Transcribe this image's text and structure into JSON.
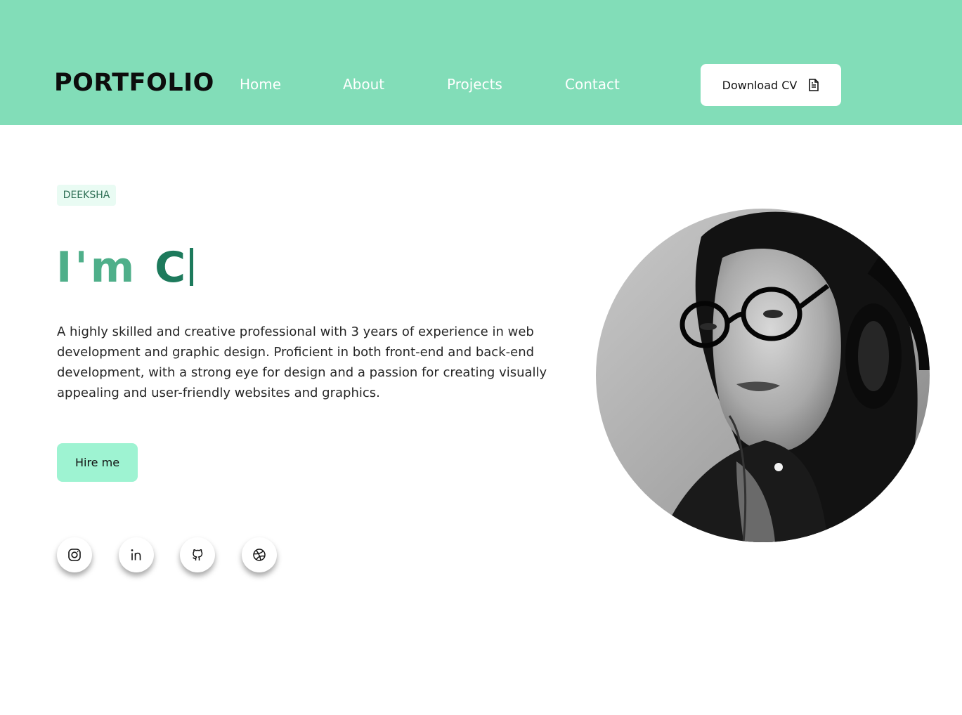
{
  "header": {
    "logo": "PORTFOLIO",
    "nav": [
      "Home",
      "About",
      "Projects",
      "Contact"
    ],
    "cv_button": {
      "label": "Download CV",
      "icon": "document-icon"
    }
  },
  "hero": {
    "badge": "DEEKSHA",
    "headline_part1": "I'm ",
    "headline_part2": "C",
    "bio": "A highly skilled and creative professional with 3 years of experience in web development and graphic design. Proficient in both front-end and back-end development, with a strong eye for design and a passion for creating visually appealing and user-friendly websites and graphics.",
    "hire_button": "Hire me"
  },
  "social": [
    {
      "name": "instagram",
      "icon": "instagram-icon"
    },
    {
      "name": "linkedin",
      "icon": "linkedin-icon"
    },
    {
      "name": "github",
      "icon": "github-icon"
    },
    {
      "name": "dribbble",
      "icon": "dribbble-icon"
    }
  ],
  "colors": {
    "nav_bg": "#82ddb8",
    "accent_light": "#4faf8a",
    "accent_dark": "#1d7a5c",
    "hire_bg": "#9ef3d2",
    "badge_bg": "#e9fbf3"
  }
}
